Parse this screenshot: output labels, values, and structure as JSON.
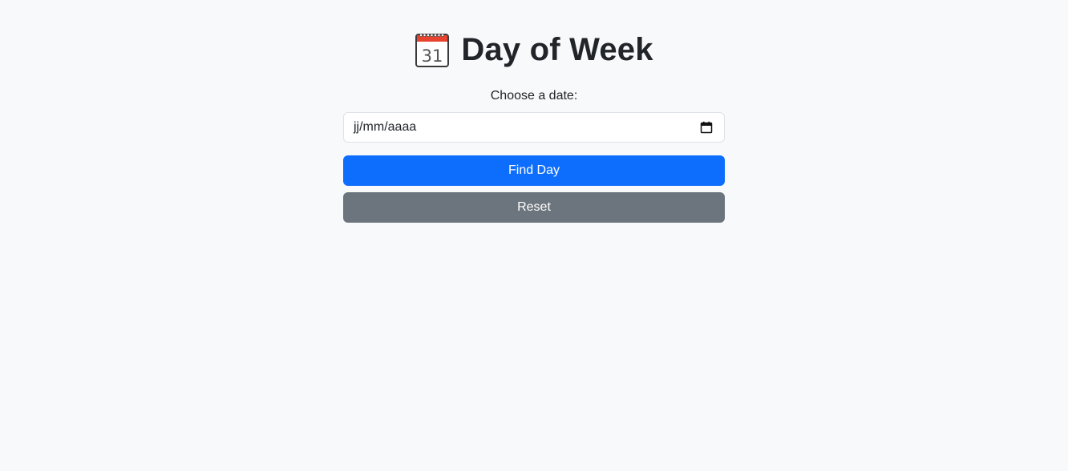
{
  "header": {
    "title": "Day of Week",
    "icon": "calendar-icon",
    "icon_label": "31"
  },
  "form": {
    "label": "Choose a date:",
    "date_placeholder": "jj/mm/aaaa",
    "find_button_label": "Find Day",
    "reset_button_label": "Reset"
  },
  "colors": {
    "background": "#f8f9fa",
    "primary": "#0d6efd",
    "secondary": "#6c757d",
    "text": "#212529"
  }
}
